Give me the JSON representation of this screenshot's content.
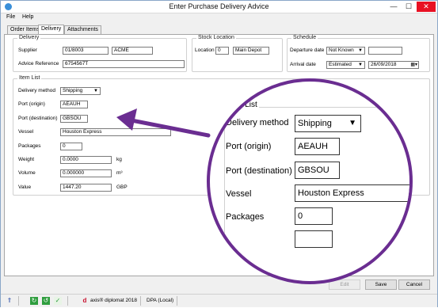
{
  "window": {
    "title": "Enter Purchase Delivery Advice",
    "minimize": "—",
    "maximize": "☐",
    "close": "✕"
  },
  "menu": {
    "file": "File",
    "help": "Help"
  },
  "tabs": [
    {
      "label": "Order Items"
    },
    {
      "label": "Delivery"
    },
    {
      "label": "Attachments"
    }
  ],
  "delivery": {
    "group_title": "Delivery",
    "supplier_label": "Supplier",
    "supplier_code": "01/8003",
    "supplier_name": "ACME",
    "advice_ref_label": "Advice Reference",
    "advice_ref": "6754567T"
  },
  "stock_location": {
    "group_title": "Stock Location",
    "location_label": "Location",
    "location_code": "0",
    "location_name": "Main Depot"
  },
  "schedule": {
    "group_title": "Schedule",
    "departure_label": "Departure date",
    "departure_type": "Not Known",
    "departure_value": "",
    "arrival_label": "Arrival date",
    "arrival_type": "Estimated",
    "arrival_value": "26/09/2018"
  },
  "item_list": {
    "group_title": "Item List",
    "delivery_method_label": "Delivery method",
    "delivery_method": "Shipping",
    "port_origin_label": "Port (origin)",
    "port_origin": "AEAUH",
    "port_dest_label": "Port (destination)",
    "port_dest": "GBSOU",
    "vessel_label": "Vessel",
    "vessel": "Houston Express",
    "packages_label": "Packages",
    "packages": "0",
    "weight_label": "Weight",
    "weight": "0.0000",
    "weight_unit": "kg",
    "volume_label": "Volume",
    "volume": "0.000000",
    "volume_unit": "m³",
    "value_label": "Value",
    "value": "1447.20",
    "value_unit": "GBP"
  },
  "zoom": {
    "group_title": "Item List",
    "delivery_method_label": "Delivery method",
    "delivery_method": "Shipping",
    "port_origin_label": "Port (origin)",
    "port_origin": "AEAUH",
    "port_dest_label": "Port (destination)",
    "port_dest": "GBSOU",
    "vessel_label": "Vessel",
    "vessel": "Houston Express",
    "packages_label": "Packages",
    "packages": "0"
  },
  "buttons": {
    "edit": "Edit",
    "save": "Save",
    "cancel": "Cancel"
  },
  "status": {
    "product": "axis® diplomat 2018",
    "db": "DPA (Local)",
    "logo_text": "d"
  },
  "colors": {
    "accent": "#6a2d91",
    "close": "#e81123"
  }
}
